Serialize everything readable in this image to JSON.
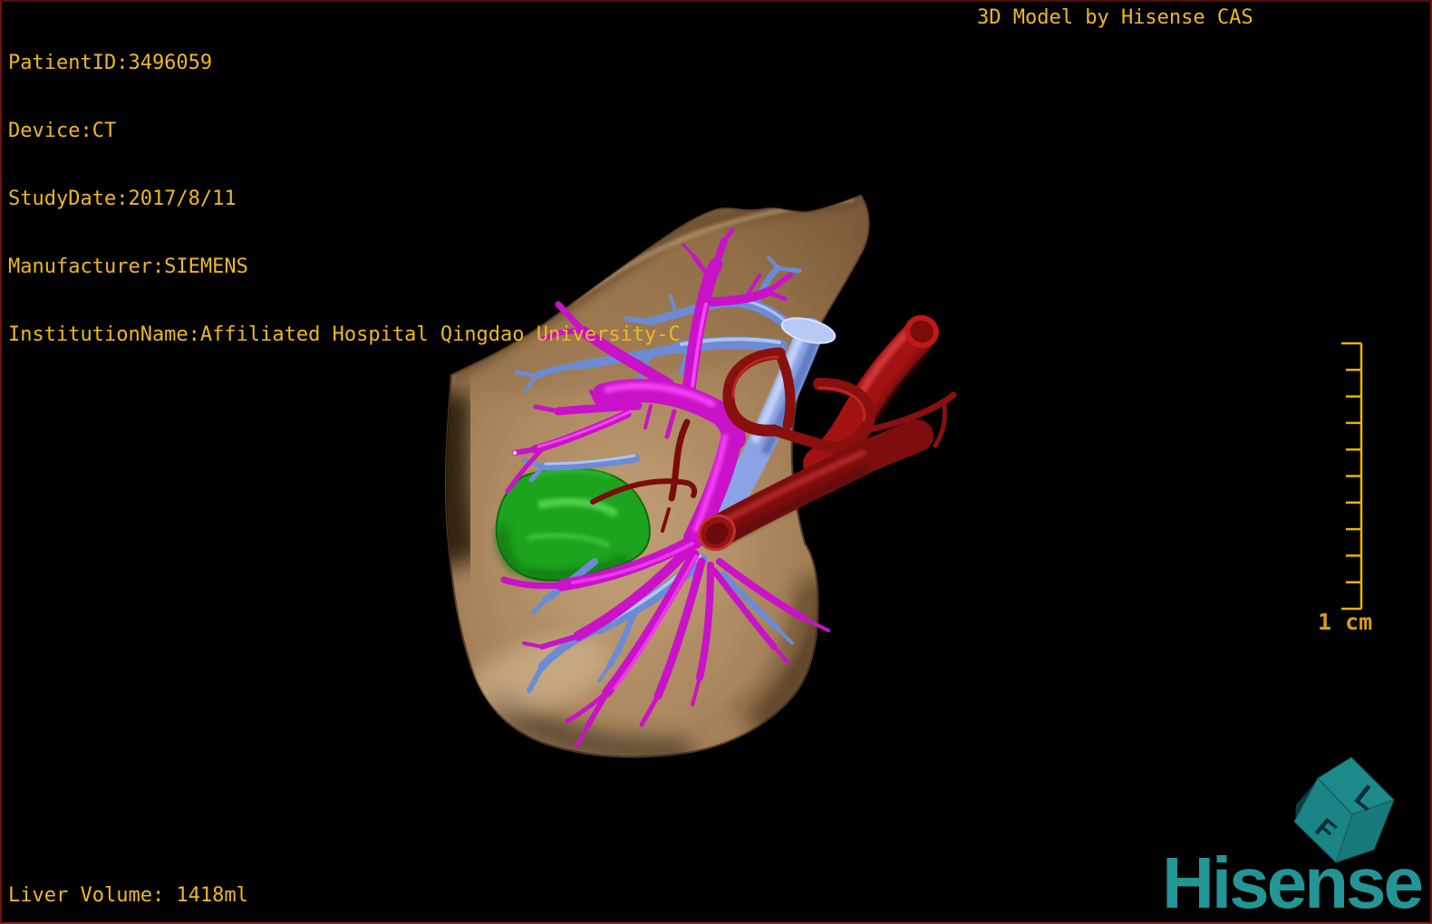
{
  "overlay": {
    "patient_lines": [
      "PatientID:3496059",
      "Device:CT",
      "StudyDate:2017/8/11",
      "Manufacturer:SIEMENS",
      "InstitutionName:Affiliated Hospital Qingdao University-C"
    ],
    "watermark": "3D Model by Hisense CAS",
    "liver_volume": "Liver Volume: 1418ml"
  },
  "scale_bar": {
    "label": "1 cm",
    "tick_count": 11
  },
  "orientation_cube": {
    "front_label": "F",
    "left_label": "L"
  },
  "branding": {
    "logo_text": "Hisense"
  },
  "colors": {
    "overlay_text": "#eeb91f",
    "scale_bar": "#e8b400",
    "border_red": "#6e1212",
    "background": "#000000",
    "brand_teal": "#249595",
    "liver": "#ac8960",
    "gallbladder": "#1ea31e",
    "portal_vein": "#c912c9",
    "hepatic_vein": "#6c8bd4",
    "inferior_vena_cava": "#8aa3e5",
    "hepatic_artery": "#8a0f0f",
    "aorta": "#a31212"
  },
  "model": {
    "structures": [
      {
        "name": "liver",
        "color": "#ac8960"
      },
      {
        "name": "gallbladder",
        "color": "#1ea31e"
      },
      {
        "name": "portal-vein",
        "color": "#c912c9"
      },
      {
        "name": "hepatic-veins",
        "color": "#6c8bd4"
      },
      {
        "name": "inferior-vena-cava",
        "color": "#8aa3e5"
      },
      {
        "name": "hepatic-artery",
        "color": "#8a0f0f"
      },
      {
        "name": "aorta",
        "color": "#a31212"
      }
    ]
  }
}
